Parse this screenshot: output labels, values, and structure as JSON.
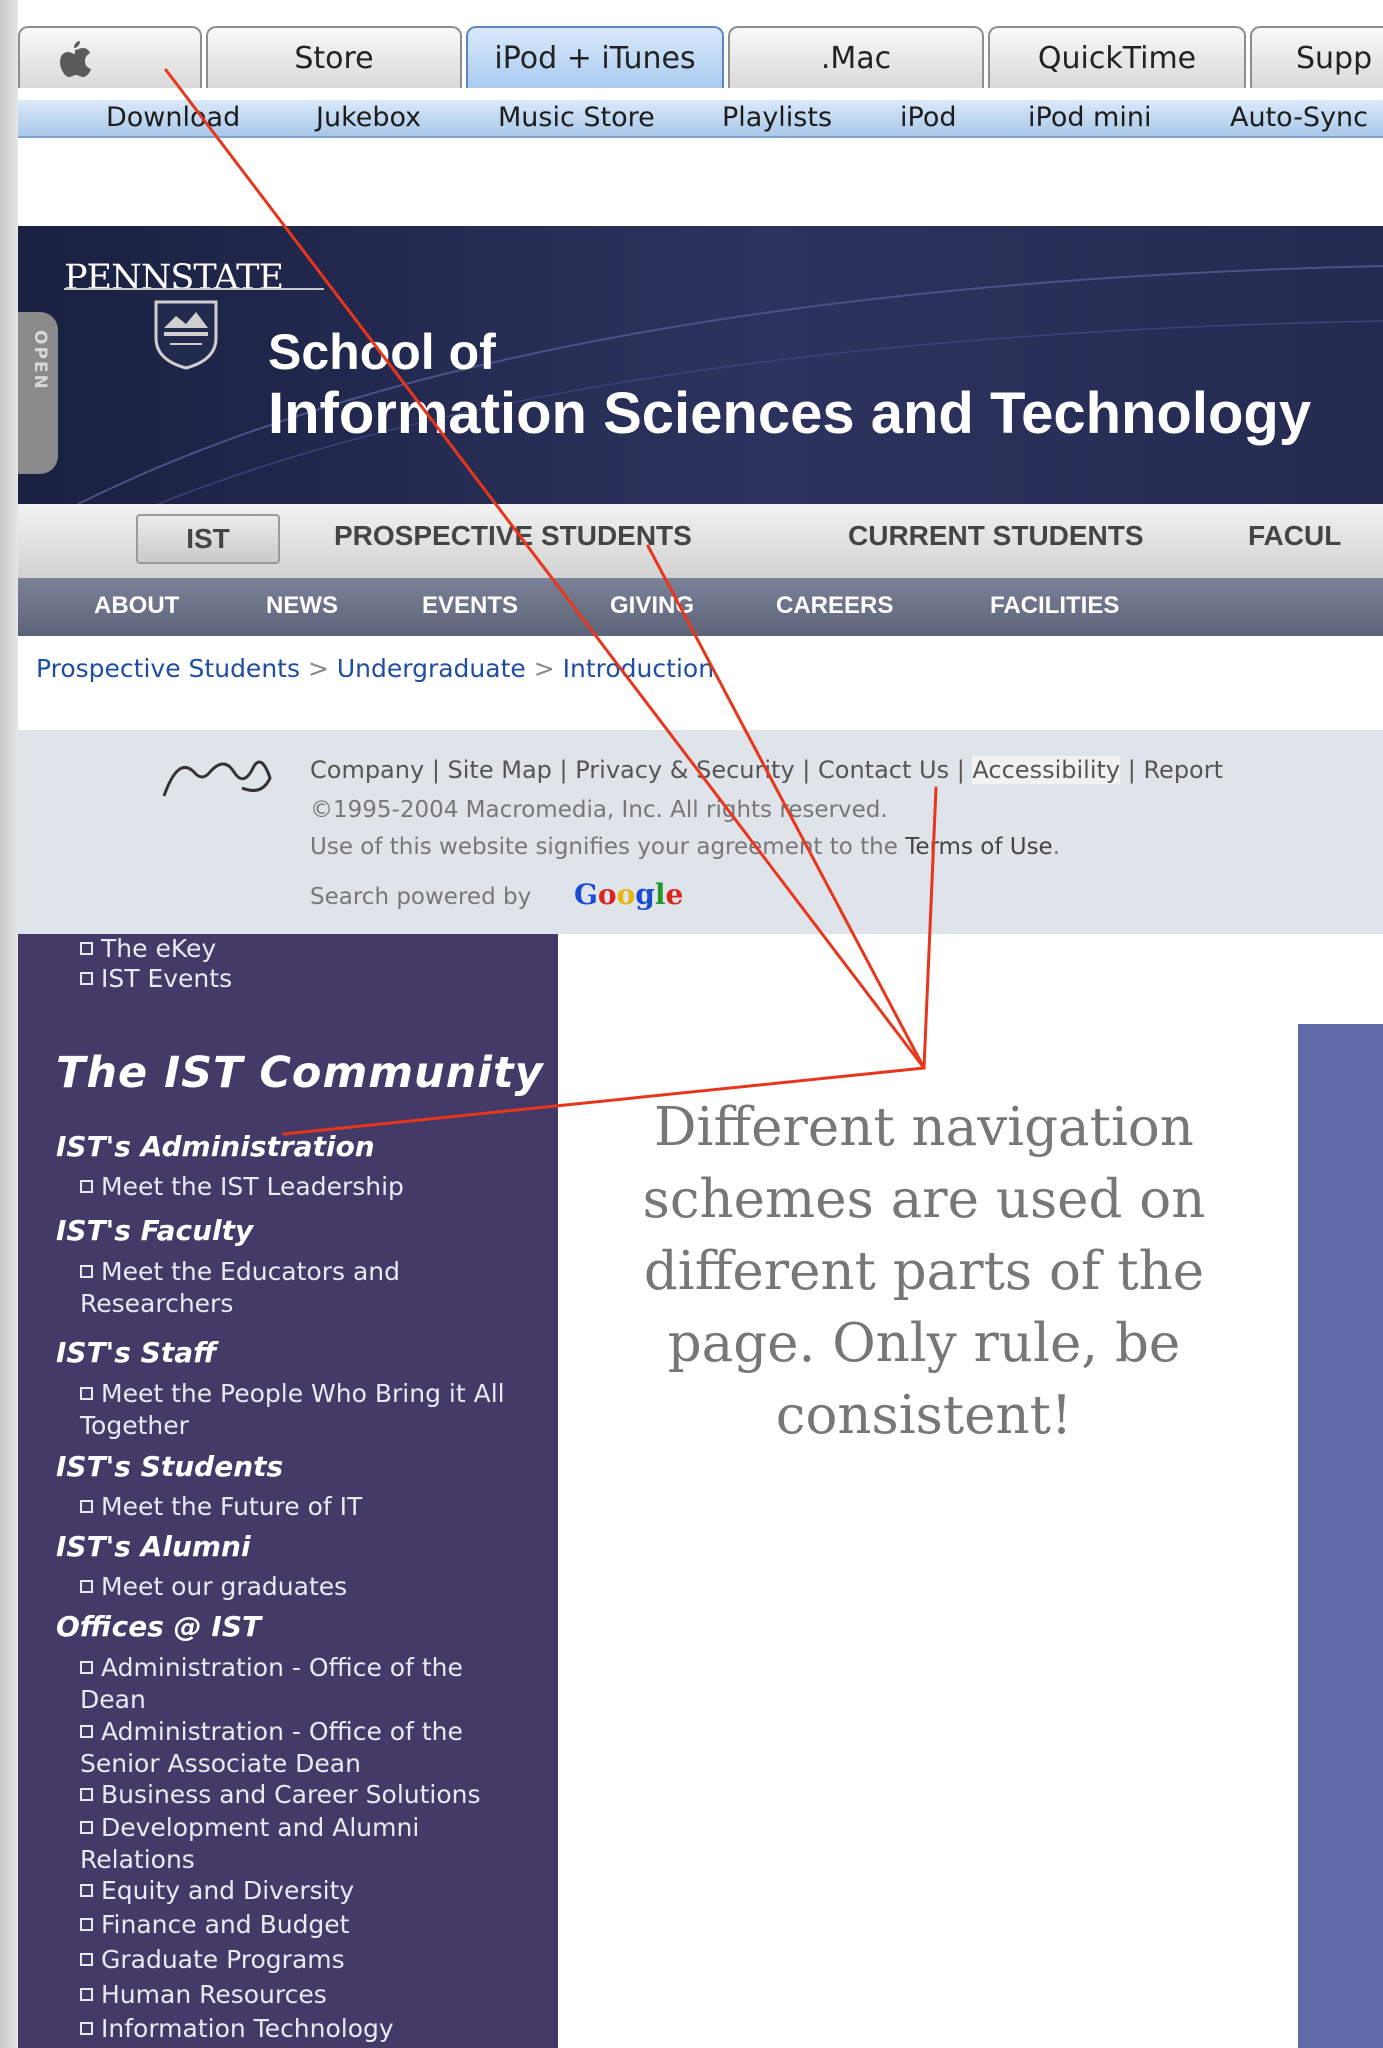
{
  "apple_nav": {
    "tabs": [
      {
        "label": "",
        "icon": "apple-logo-icon"
      },
      {
        "label": "Store"
      },
      {
        "label": "iPod + iTunes",
        "active": true
      },
      {
        "label": ".Mac"
      },
      {
        "label": "QuickTime"
      },
      {
        "label": "Supp"
      }
    ],
    "subnav": [
      "Download",
      "Jukebox",
      "Music Store",
      "Playlists",
      "iPod",
      "iPod mini",
      "Auto-Sync"
    ]
  },
  "psu_header": {
    "open_tab": "OPEN",
    "wordmark": "PENNSTATE",
    "school_line1": "School of",
    "school_line2": "Information Sciences and Technology"
  },
  "main_nav": [
    "IST",
    "PROSPECTIVE STUDENTS",
    "CURRENT STUDENTS",
    "FACUL"
  ],
  "sec_nav": [
    "ABOUT",
    "NEWS",
    "EVENTS",
    "GIVING",
    "CAREERS",
    "FACILITIES"
  ],
  "breadcrumb": {
    "items": [
      "Prospective Students",
      "Undergraduate",
      "Introduction"
    ],
    "separator": ">"
  },
  "macromedia_footer": {
    "links": [
      "Company",
      "Site Map",
      "Privacy & Security",
      "Contact Us",
      "Accessibility",
      "Report"
    ],
    "copyright": "©1995-2004 Macromedia, Inc. All rights reserved.",
    "terms_prefix": "Use of this website signifies your agreement to the ",
    "terms_link": "Terms of Use",
    "terms_suffix": ".",
    "search_prefix": "Search powered by",
    "google": "Google"
  },
  "sidebar": {
    "top_links": [
      "The eKey",
      "IST Events"
    ],
    "community_title": "The IST Community",
    "sections": [
      {
        "title": "IST's Administration",
        "links": [
          "Meet the IST Leadership"
        ]
      },
      {
        "title": "IST's Faculty",
        "links": [
          "Meet the Educators and Researchers"
        ]
      },
      {
        "title": "IST's Staff",
        "links": [
          "Meet the People Who Bring it All Together"
        ]
      },
      {
        "title": "IST's Students",
        "links": [
          "Meet the Future of IT"
        ]
      },
      {
        "title": "IST's Alumni",
        "links": [
          "Meet our graduates"
        ]
      },
      {
        "title": "Offices @ IST",
        "links": [
          "Administration - Office of the Dean",
          "Administration - Office of the Senior Associate Dean",
          "Business and Career Solutions",
          "Development and Alumni Relations",
          "Equity and Diversity",
          "Finance and Budget",
          "Graduate Programs",
          "Human Resources",
          "Information Technology"
        ]
      }
    ]
  },
  "caption": "Different navigation schemes are used on different parts of the page.  Only rule, be consistent!",
  "colors": {
    "annotation_arrow": "#e8361c",
    "sidebar": "#433a67",
    "blue_panel": "#5e6ba8",
    "link": "#1f4da3"
  }
}
